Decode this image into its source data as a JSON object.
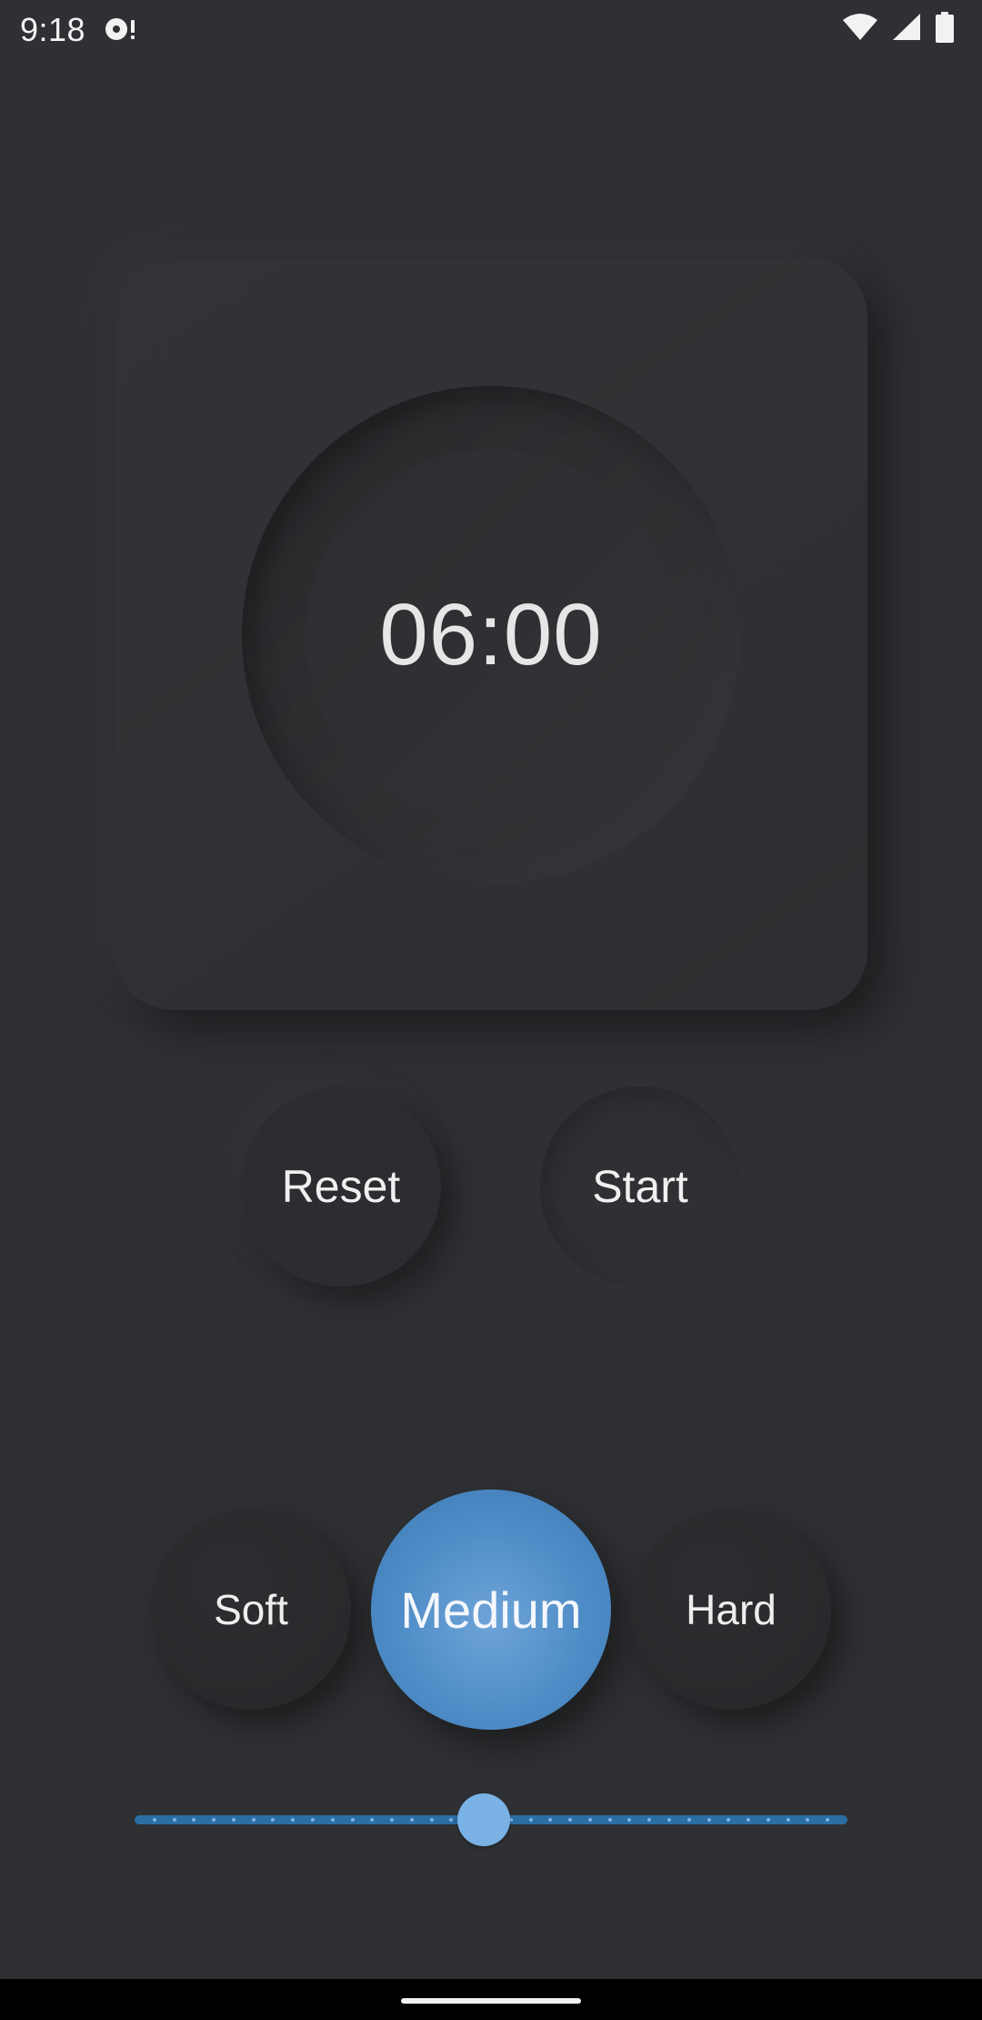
{
  "status_bar": {
    "time": "9:18",
    "icons": [
      "notification-media-icon",
      "wifi-icon",
      "cell-signal-icon",
      "battery-icon"
    ]
  },
  "timer": {
    "display": "06:00"
  },
  "controls": {
    "reset_label": "Reset",
    "start_label": "Start"
  },
  "hardness": {
    "options": [
      "Soft",
      "Medium",
      "Hard"
    ],
    "selected": "Medium",
    "soft_label": "Soft",
    "medium_label": "Medium",
    "hard_label": "Hard"
  },
  "slider": {
    "fraction": 0.49
  },
  "colors": {
    "background": "#2f3033",
    "accent": "#4d8bc6",
    "slider_track": "#2a6ea3",
    "slider_thumb": "#7ab2e6"
  }
}
